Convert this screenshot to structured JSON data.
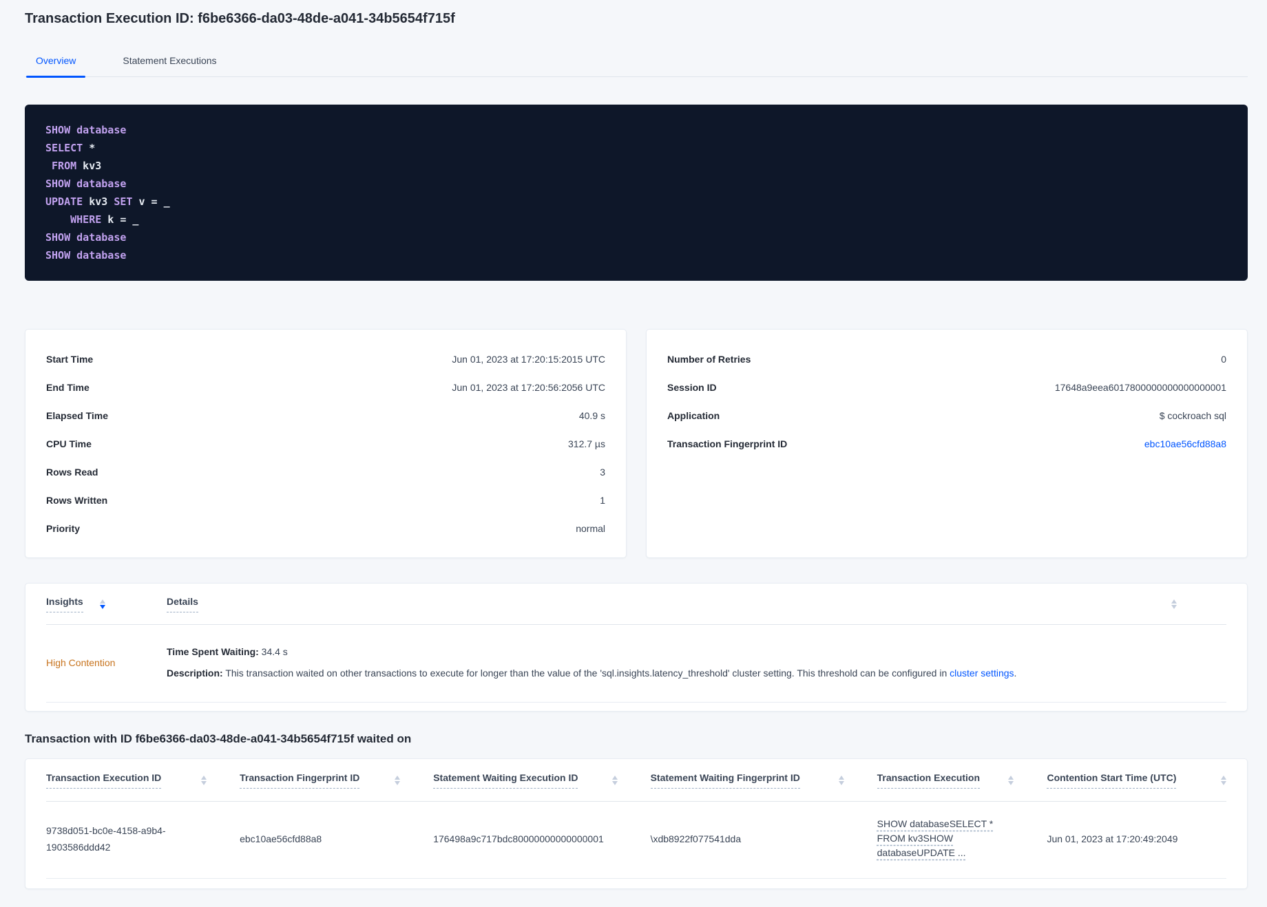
{
  "page": {
    "title": "Transaction Execution ID: f6be6366-da03-48de-a041-34b5654f715f"
  },
  "tabs": [
    {
      "label": "Overview",
      "active": true
    },
    {
      "label": "Statement Executions",
      "active": false
    }
  ],
  "sql": {
    "lines": [
      [
        {
          "text": "SHOW database",
          "kw": true
        }
      ],
      [
        {
          "text": "SELECT",
          "kw": true
        },
        {
          "text": " *",
          "kw": false
        }
      ],
      [
        {
          "text": " FROM",
          "kw": true
        },
        {
          "text": " kv3",
          "kw": false
        }
      ],
      [
        {
          "text": "SHOW database",
          "kw": true
        }
      ],
      [
        {
          "text": "UPDATE",
          "kw": true
        },
        {
          "text": " kv3 ",
          "kw": false
        },
        {
          "text": "SET",
          "kw": true
        },
        {
          "text": " v = _",
          "kw": false
        }
      ],
      [
        {
          "text": "    WHERE",
          "kw": true
        },
        {
          "text": " k = _",
          "kw": false
        }
      ],
      [
        {
          "text": "SHOW database",
          "kw": true
        }
      ],
      [
        {
          "text": "SHOW database",
          "kw": true
        }
      ]
    ]
  },
  "details_left": {
    "rows": [
      {
        "label": "Start Time",
        "value": "Jun 01, 2023 at 17:20:15:2015 UTC"
      },
      {
        "label": "End Time",
        "value": "Jun 01, 2023 at 17:20:56:2056 UTC"
      },
      {
        "label": "Elapsed Time",
        "value": "40.9 s"
      },
      {
        "label": "CPU Time",
        "value": "312.7 µs"
      },
      {
        "label": "Rows Read",
        "value": "3"
      },
      {
        "label": "Rows Written",
        "value": "1"
      },
      {
        "label": "Priority",
        "value": "normal"
      }
    ]
  },
  "details_right": {
    "rows": [
      {
        "label": "Number of Retries",
        "value": "0"
      },
      {
        "label": "Session ID",
        "value": "17648a9eea6017800000000000000001"
      },
      {
        "label": "Application",
        "value": "$ cockroach sql"
      },
      {
        "label": "Transaction Fingerprint ID",
        "value": "ebc10ae56cfd88a8",
        "link": true
      }
    ]
  },
  "insights": {
    "columns": [
      {
        "label": "Insights",
        "sort": "desc"
      },
      {
        "label": "Details",
        "sort": null
      }
    ],
    "row": {
      "insight": "High Contention",
      "waiting_label": "Time Spent Waiting:",
      "waiting_value": " 34.4 s",
      "description_label": "Description:",
      "description_text": " This transaction waited on other transactions to execute for longer than the value of the 'sql.insights.latency_threshold' cluster setting. This threshold can be configured in ",
      "link_text": "cluster settings",
      "suffix": "."
    }
  },
  "waited_section": {
    "title": "Transaction with ID f6be6366-da03-48de-a041-34b5654f715f waited on",
    "columns": [
      "Transaction Execution ID",
      "Transaction Fingerprint ID",
      "Statement Waiting Execution ID",
      "Statement Waiting Fingerprint ID",
      "Transaction Execution",
      "Contention Start Time (UTC)"
    ],
    "rows": [
      {
        "transaction_execution_id": "9738d051-bc0e-4158-a9b4-1903586ddd42",
        "transaction_fingerprint_id": "ebc10ae56cfd88a8",
        "statement_waiting_execution_id": "176498a9c717bdc80000000000000001",
        "statement_waiting_fingerprint_id": "\\xdb8922f077541dda",
        "transaction_execution": "SHOW databaseSELECT * FROM kv3SHOW databaseUPDATE ...",
        "contention_start_time": "Jun 01, 2023 at 17:20:49:2049"
      }
    ]
  },
  "colors": {
    "accent_blue": "#0055ff",
    "insight_warning_orange": "#c7731d",
    "sql_keyword_purple": "#c2a2f0",
    "sql_plain_text": "#e7ecf3",
    "sql_background": "#0e1729",
    "page_background": "#f5f7fa",
    "card_background": "#ffffff",
    "heading_text": "#242a35",
    "body_text": "#394455"
  }
}
